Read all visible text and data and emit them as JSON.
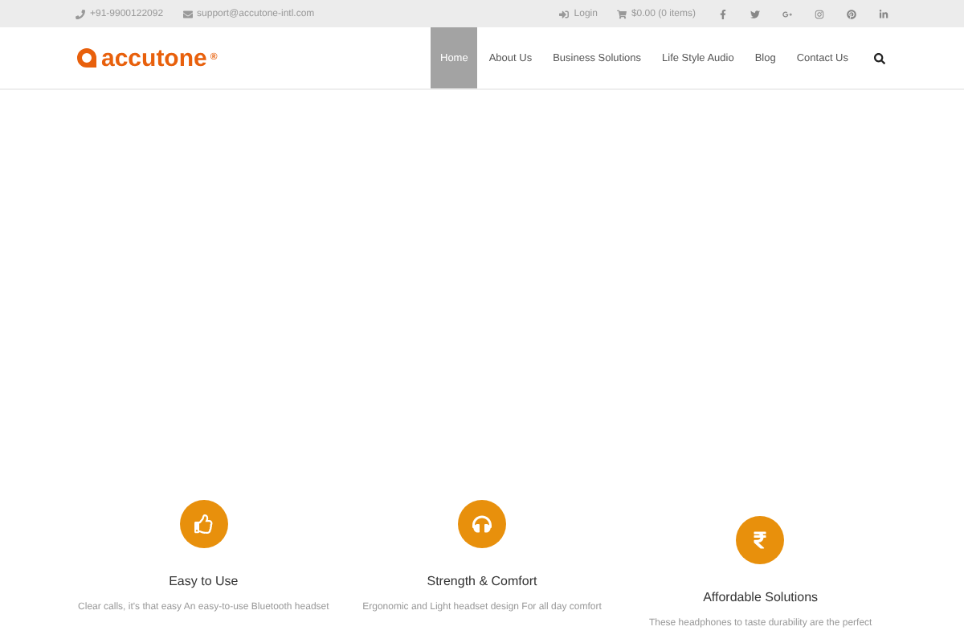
{
  "top_bar": {
    "phone": "+91-9900122092",
    "email": "support@accutone-intl.com",
    "login": "Login",
    "cart": "$0.00 (0 items)"
  },
  "logo": {
    "text": "accutone",
    "mark": "®"
  },
  "nav": [
    {
      "label": "Home",
      "selected": true
    },
    {
      "label": "About Us",
      "selected": false
    },
    {
      "label": "Business Solutions",
      "selected": false
    },
    {
      "label": "Life Style Audio",
      "selected": false
    },
    {
      "label": "Blog",
      "selected": false
    },
    {
      "label": "Contact Us",
      "selected": false
    }
  ],
  "features": [
    {
      "kind": "thumb",
      "title": "Easy to Use",
      "text": "Clear calls, it's that easy An easy-to-use Bluetooth headset"
    },
    {
      "kind": "headphones",
      "title": "Strength & Comfort",
      "text": "Ergonomic and Light headset design For all day comfort"
    },
    {
      "kind": "rupee",
      "title": "Affordable Solutions",
      "text": "These headphones to taste durability are the perfect"
    }
  ]
}
